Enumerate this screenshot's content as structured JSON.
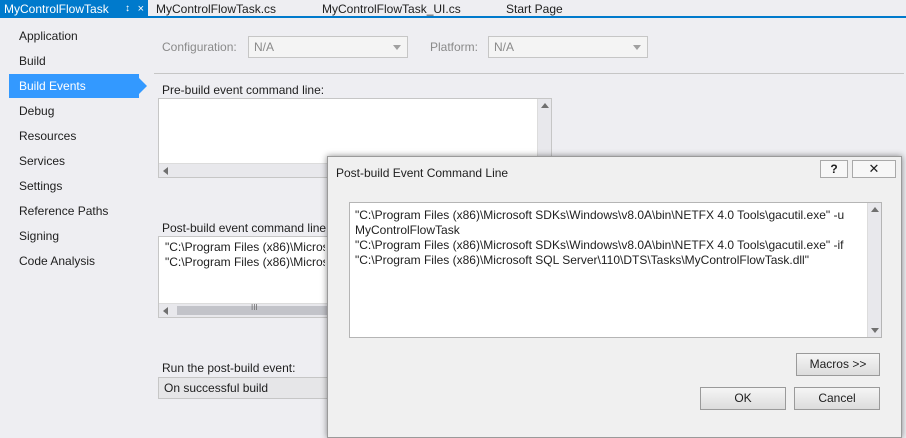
{
  "tabs": {
    "active": "MyControlFlowTask",
    "pin_glyph": "↕",
    "close_glyph": "×",
    "others": [
      "MyControlFlowTask.cs",
      "MyControlFlowTask_UI.cs",
      "Start Page"
    ]
  },
  "nav": {
    "items": [
      {
        "label": "Application"
      },
      {
        "label": "Build"
      },
      {
        "label": "Build Events"
      },
      {
        "label": "Debug"
      },
      {
        "label": "Resources"
      },
      {
        "label": "Services"
      },
      {
        "label": "Settings"
      },
      {
        "label": "Reference Paths"
      },
      {
        "label": "Signing"
      },
      {
        "label": "Code Analysis"
      }
    ],
    "selected": "Build Events"
  },
  "config": {
    "configuration_label": "Configuration:",
    "configuration_value": "N/A",
    "platform_label": "Platform:",
    "platform_value": "N/A"
  },
  "prebuild": {
    "label": "Pre-build event command line:",
    "value": ""
  },
  "postbuild": {
    "label": "Post-build event command line:",
    "value": "\"C:\\Program Files (x86)\\Microsoft SDKs\\Windows\\v8.0A\\bin\\NETFX 4.0 Tools\\gacutil.exe\" -u MyControlFlowTask\n\"C:\\Program Files (x86)\\Microsoft SDKs\\Windows\\v8.0A\\bin\\NETFX 4.0 Tools\\gacutil.exe\" -if"
  },
  "run_event": {
    "label": "Run the post-build event:",
    "value": "On successful build"
  },
  "scroll_grip": "III",
  "dialog": {
    "title": "Post-build Event Command Line",
    "help_label": "?",
    "close_label": "✕",
    "content": "\"C:\\Program Files (x86)\\Microsoft SDKs\\Windows\\v8.0A\\bin\\NETFX 4.0 Tools\\gacutil.exe\" -u\nMyControlFlowTask\n\"C:\\Program Files (x86)\\Microsoft SDKs\\Windows\\v8.0A\\bin\\NETFX 4.0 Tools\\gacutil.exe\" -if\n\"C:\\Program Files (x86)\\Microsoft SQL Server\\110\\DTS\\Tasks\\MyControlFlowTask.dll\"",
    "macros_label": "Macros >>",
    "ok_label": "OK",
    "cancel_label": "Cancel"
  },
  "colors": {
    "accent": "#007acc",
    "selection": "#3399ff",
    "background": "#eeeef2"
  }
}
